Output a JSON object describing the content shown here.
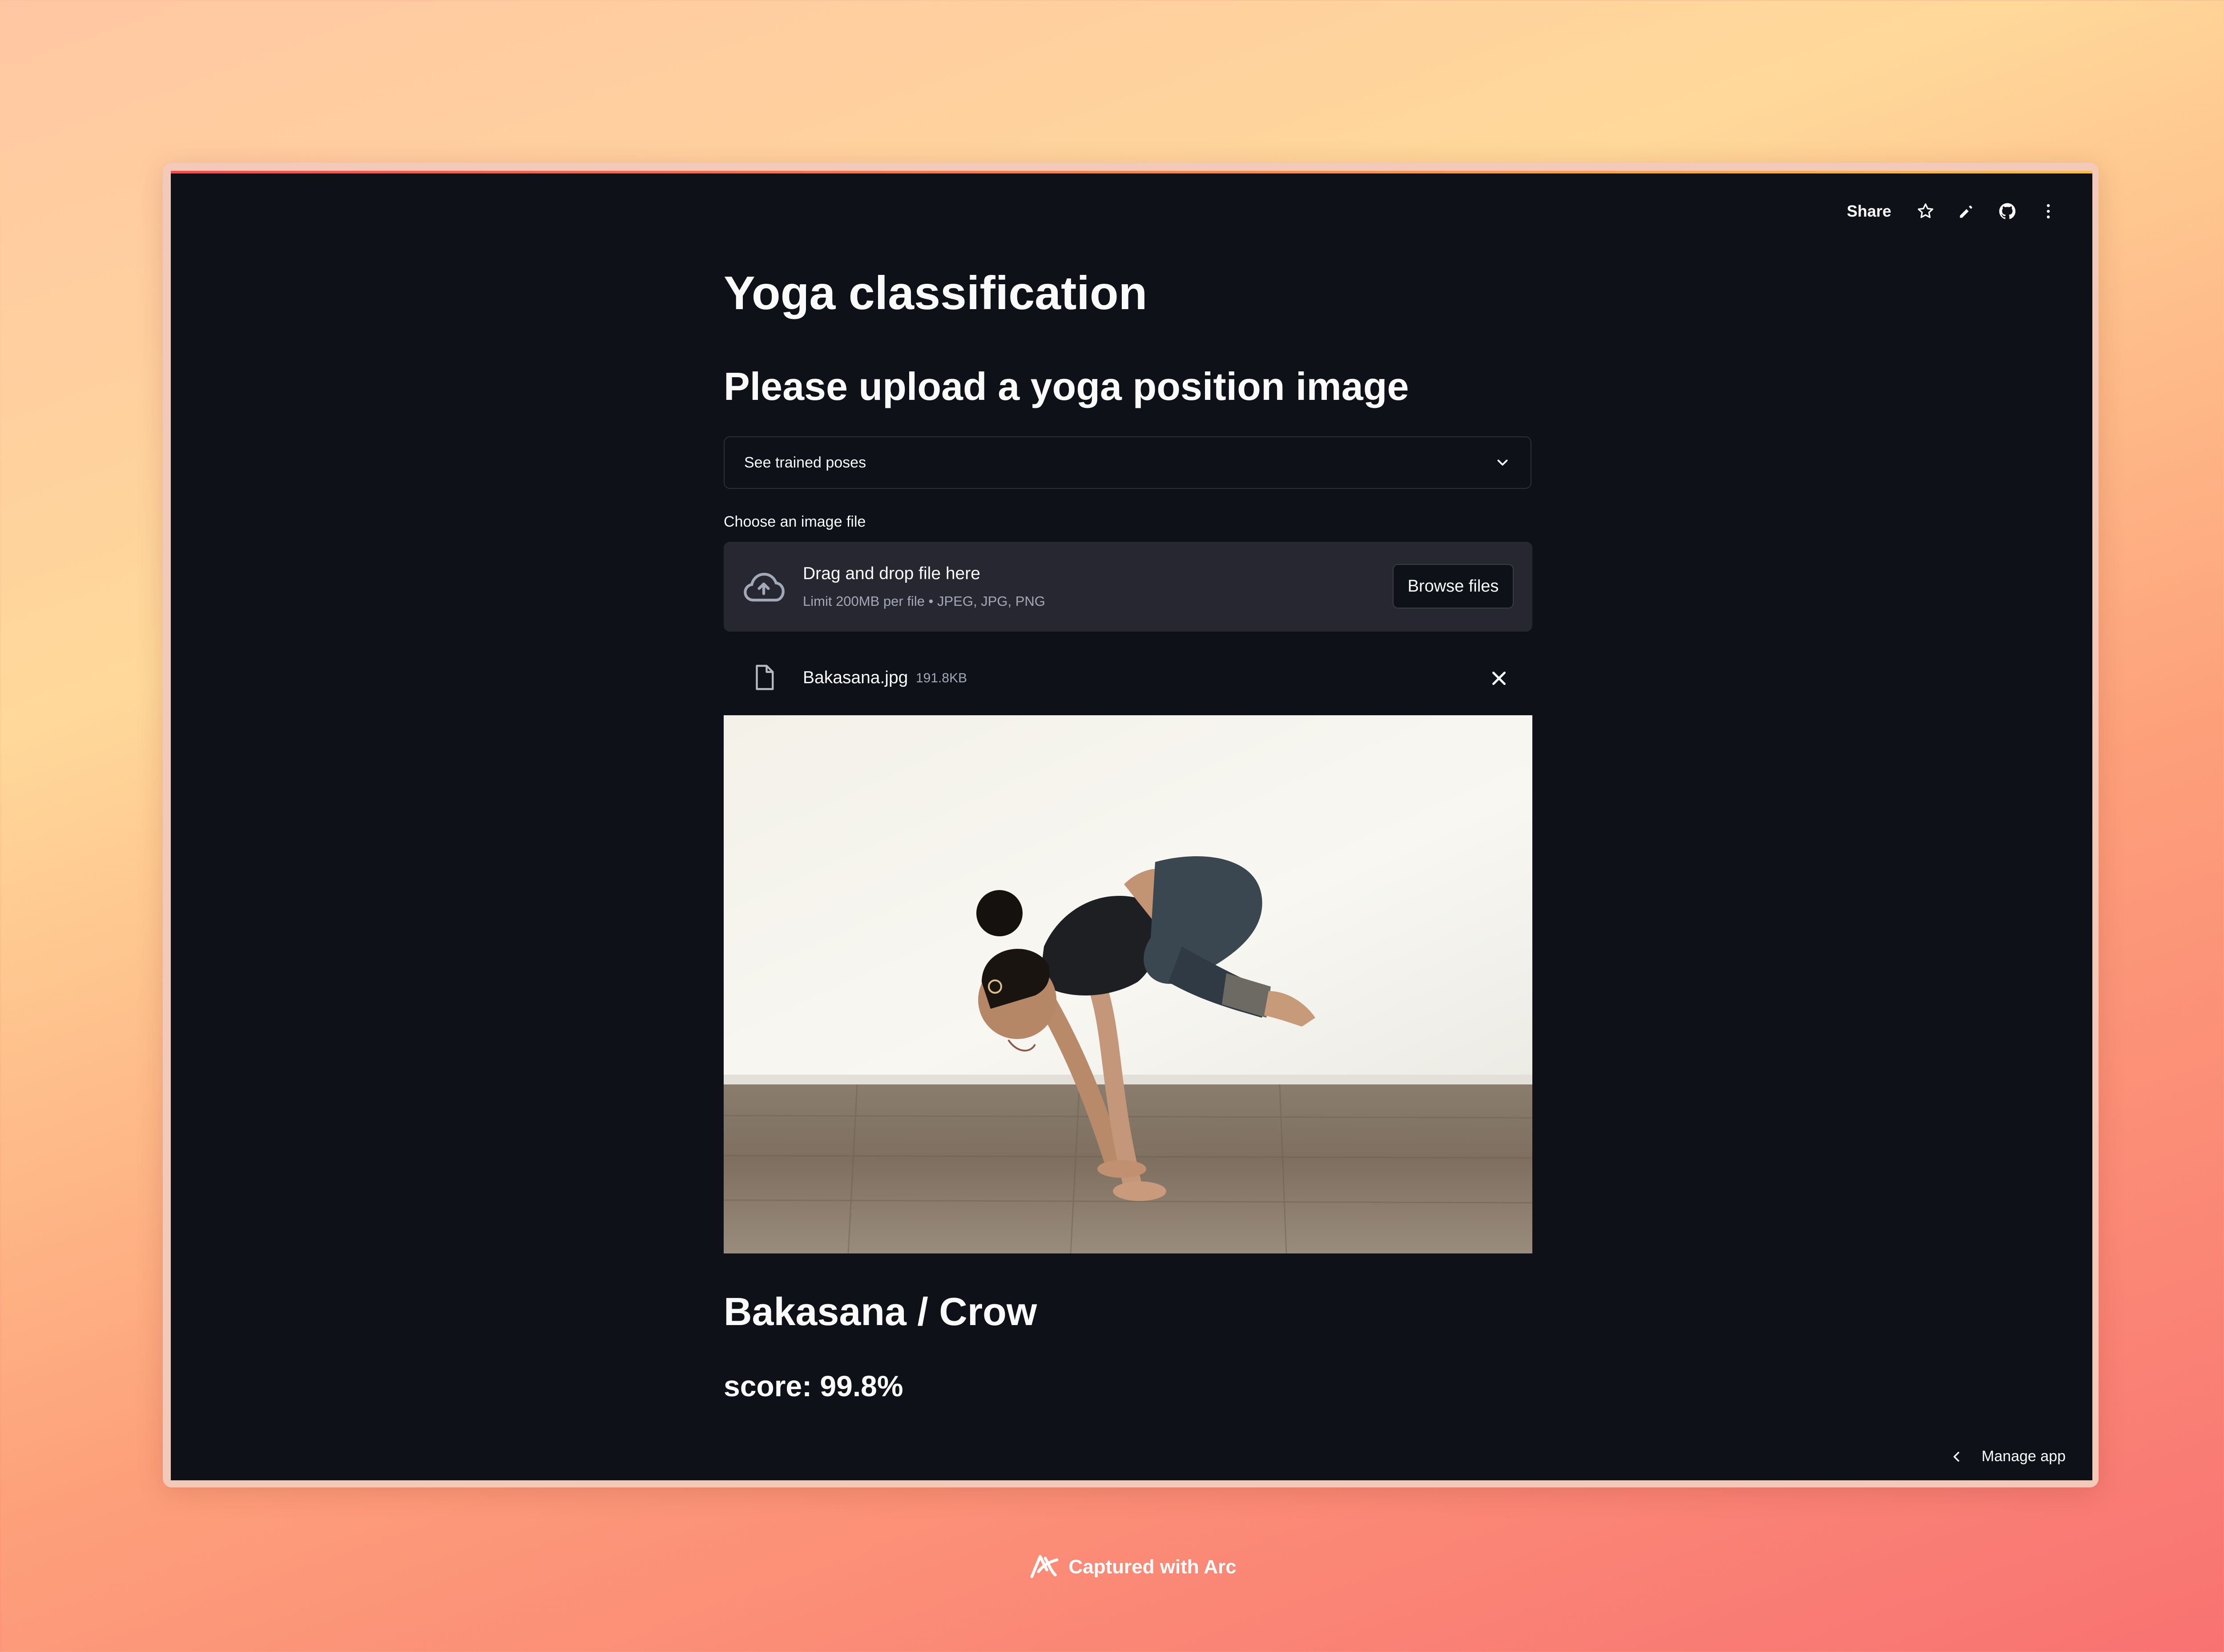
{
  "toolbar": {
    "share_label": "Share",
    "icons": [
      "star-icon",
      "pencil-icon",
      "github-icon",
      "more-vertical-icon"
    ]
  },
  "page": {
    "title": "Yoga classification",
    "subtitle": "Please upload a yoga position image"
  },
  "expander": {
    "label": "See trained poses",
    "icon": "chevron-down-icon"
  },
  "uploader": {
    "label": "Choose an image file",
    "drop_title": "Drag and drop file here",
    "drop_hint": "Limit 200MB per file • JPEG, JPG, PNG",
    "browse_label": "Browse files",
    "icon": "cloud-upload-icon"
  },
  "uploaded_file": {
    "name": "Bakasana.jpg",
    "size": "191.8KB"
  },
  "result": {
    "pose": "Bakasana / Crow",
    "score": "score: 99.8%"
  },
  "manage": {
    "label": "Manage app"
  },
  "footer": {
    "text": "Captured with Arc"
  },
  "colors": {
    "app_bg": "#0e1117",
    "dropzone_bg": "#262730",
    "text": "#fafafa",
    "muted_text": "#a3a8b8",
    "accent": "#ff4b4b"
  }
}
